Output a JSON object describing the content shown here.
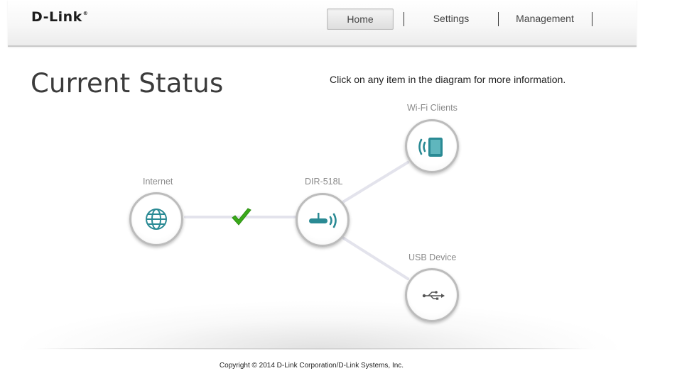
{
  "brand": {
    "logo": "D-Link",
    "trademark": "®"
  },
  "nav": {
    "tabs": [
      {
        "label": "Home",
        "active": true
      },
      {
        "label": "Settings"
      },
      {
        "label": "Management"
      }
    ]
  },
  "page": {
    "title": "Current Status",
    "hint": "Click on any item in the diagram for more information."
  },
  "diagram": {
    "internet": {
      "label": "Internet",
      "icon": "globe-icon",
      "status": "connected"
    },
    "router": {
      "label": "DIR-518L",
      "icon": "router-icon"
    },
    "wifi_clients": {
      "label": "Wi-Fi Clients",
      "icon": "tablet-wifi-icon"
    },
    "usb_device": {
      "label": "USB Device",
      "icon": "usb-icon"
    }
  },
  "colors": {
    "accent": "#2a8a94",
    "check": "#3aaa1a",
    "node_border": "#bcbcbc"
  },
  "footer": {
    "copyright": "Copyright © 2014 D-Link Corporation/D-Link Systems, Inc."
  }
}
